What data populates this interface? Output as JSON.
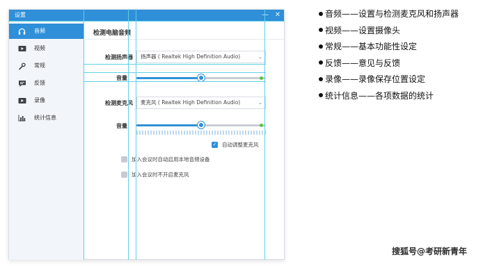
{
  "window": {
    "title": "设置",
    "minimize_glyph": "—",
    "close_glyph": "✕"
  },
  "sidebar": {
    "items": [
      {
        "label": "音频",
        "icon": "headphones-icon",
        "glyph": "🎧",
        "active": true
      },
      {
        "label": "视频",
        "icon": "video-camera-icon",
        "glyph": "▶",
        "active": false
      },
      {
        "label": "常规",
        "icon": "wrench-icon",
        "glyph": "🔧",
        "active": false
      },
      {
        "label": "反馈",
        "icon": "chat-bubble-icon",
        "glyph": "▤",
        "active": false
      },
      {
        "label": "录像",
        "icon": "record-icon",
        "glyph": "▶",
        "active": false
      },
      {
        "label": "统计信息",
        "icon": "bar-chart-icon",
        "glyph": "▮",
        "active": false
      }
    ]
  },
  "audio": {
    "section_title": "检测电脑音频",
    "speaker_label": "检测扬声器",
    "speaker_value": "扬声器 ( Realtek High Definition Audio)",
    "speaker_volume_label": "音量",
    "speaker_volume": 0.5,
    "mic_label": "检测麦克风",
    "mic_value": "麦克风 ( Realtek High Definition Audio)",
    "mic_volume_label": "音量",
    "mic_volume": 0.5,
    "auto_adjust_label": "自动调整麦克风",
    "auto_adjust_checked": true,
    "auto_enable_local_label": "加入会议时自动启用本地音频设备",
    "auto_enable_local_checked": false,
    "mute_mic_on_join_label": "加入会议时不开启麦克风",
    "mute_mic_on_join_checked": false
  },
  "notes": [
    "音频——设置与检测麦克风和扬声器",
    "视频——设置摄像头",
    "常规——基本功能性设定",
    "反馈——意见与反馈",
    "录像——录像保存位置设定",
    "统计信息——各项数据的统计"
  ],
  "watermark": "搜狐号@考研新青年",
  "colors": {
    "accent": "#2f8fd8",
    "guide": "#5fd0e6",
    "level": "#5cc13c"
  }
}
